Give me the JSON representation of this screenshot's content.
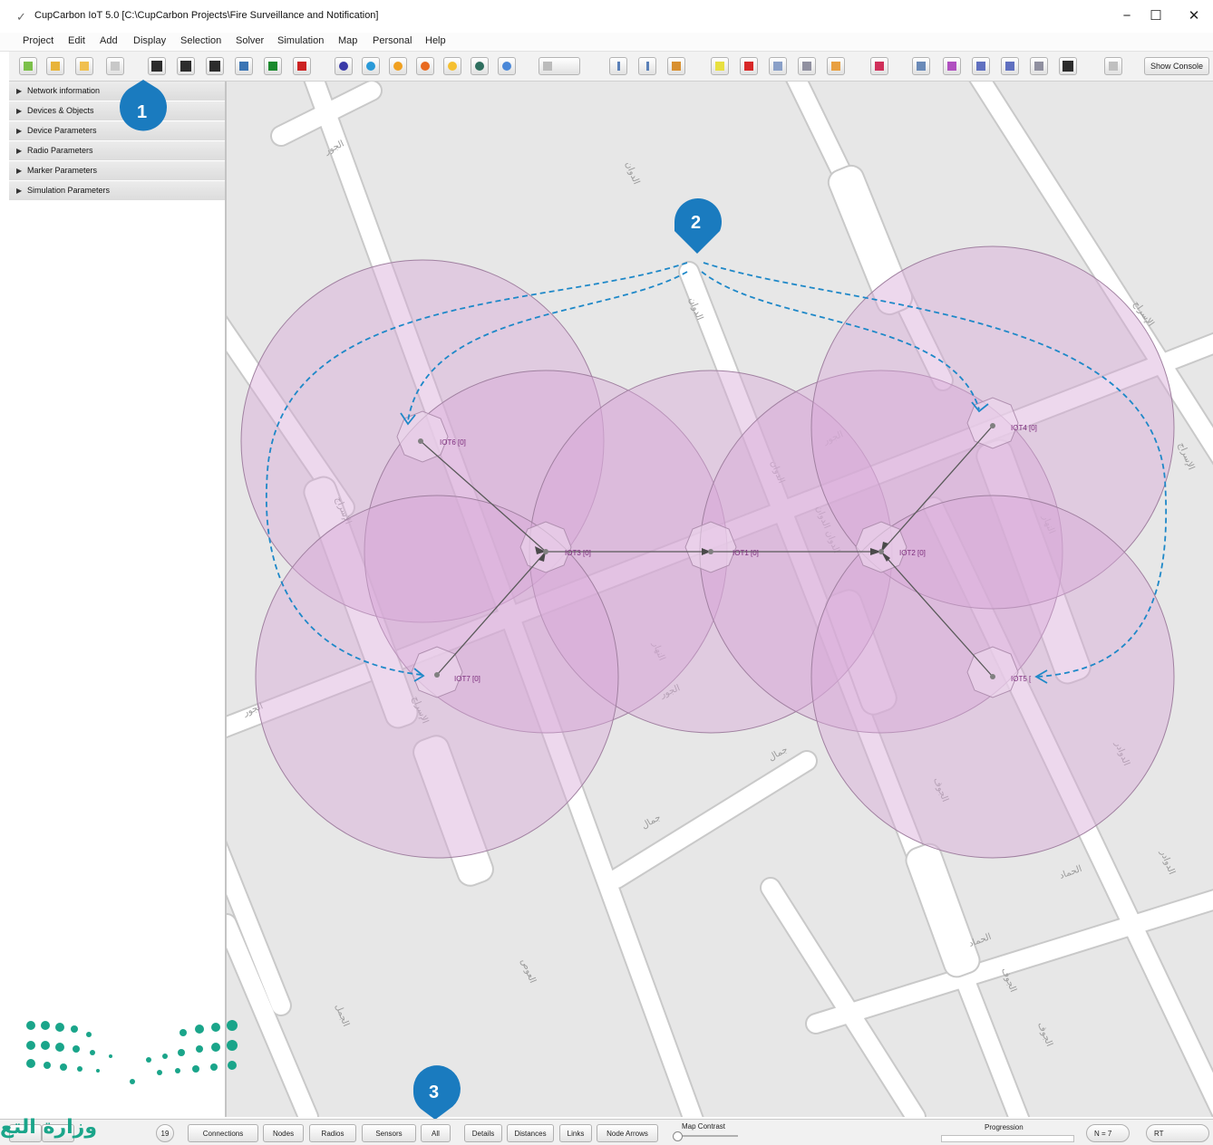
{
  "window": {
    "title": "CupCarbon IoT 5.0 [C:\\CupCarbon Projects\\Fire Surveillance and Notification]",
    "controls": {
      "minimize": "−",
      "maximize": "☐",
      "close": "✕"
    }
  },
  "menu": [
    "Project",
    "Edit",
    "Add",
    "Display",
    "Selection",
    "Solver",
    "Simulation",
    "Map",
    "Personal",
    "Help"
  ],
  "toolbar": {
    "show_console_label": "Show Console"
  },
  "left_panel": {
    "sections": [
      "Network information",
      "Devices & Objects",
      "Device Parameters",
      "Radio Parameters",
      "Marker Parameters",
      "Simulation Parameters"
    ]
  },
  "map": {
    "nodes": [
      {
        "id": "IOT6",
        "label": "IOT6 [0]"
      },
      {
        "id": "IOT3",
        "label": "IOT3 [0]"
      },
      {
        "id": "IOT1",
        "label": "IOT1 [0]"
      },
      {
        "id": "IOT2",
        "label": "IOT2 [0]"
      },
      {
        "id": "IOT4",
        "label": "IOT4 [0]"
      },
      {
        "id": "IOT7",
        "label": "IOT7 [0]"
      },
      {
        "id": "IOT5",
        "label": "IOT5 ["
      }
    ],
    "street_labels": [
      "الجور",
      "الدوان",
      "الإسراج",
      "النهار",
      "الحماد",
      "الدوادر",
      "الجوف",
      "العوص",
      "الجمل",
      "جمال",
      "الدوان الدوان"
    ]
  },
  "callouts": [
    "1",
    "2",
    "3"
  ],
  "statusbar": {
    "counter": "19",
    "buttons": [
      "Connections",
      "Nodes",
      "Radios",
      "Sensors",
      "All",
      "Details",
      "Distances",
      "Links",
      "Node Arrows"
    ],
    "map_contrast_label": "Map Contrast",
    "progression_label": "Progression",
    "node_count": "N = 7",
    "rt_label": "RT"
  },
  "watermark": {
    "text": "وزارة التع"
  },
  "colors": {
    "callout_blue": "#1a7bbf",
    "radio_fill": "#d8a8d8",
    "map_bg": "#e7e7e7",
    "arrow_blue": "#1e88c8"
  }
}
